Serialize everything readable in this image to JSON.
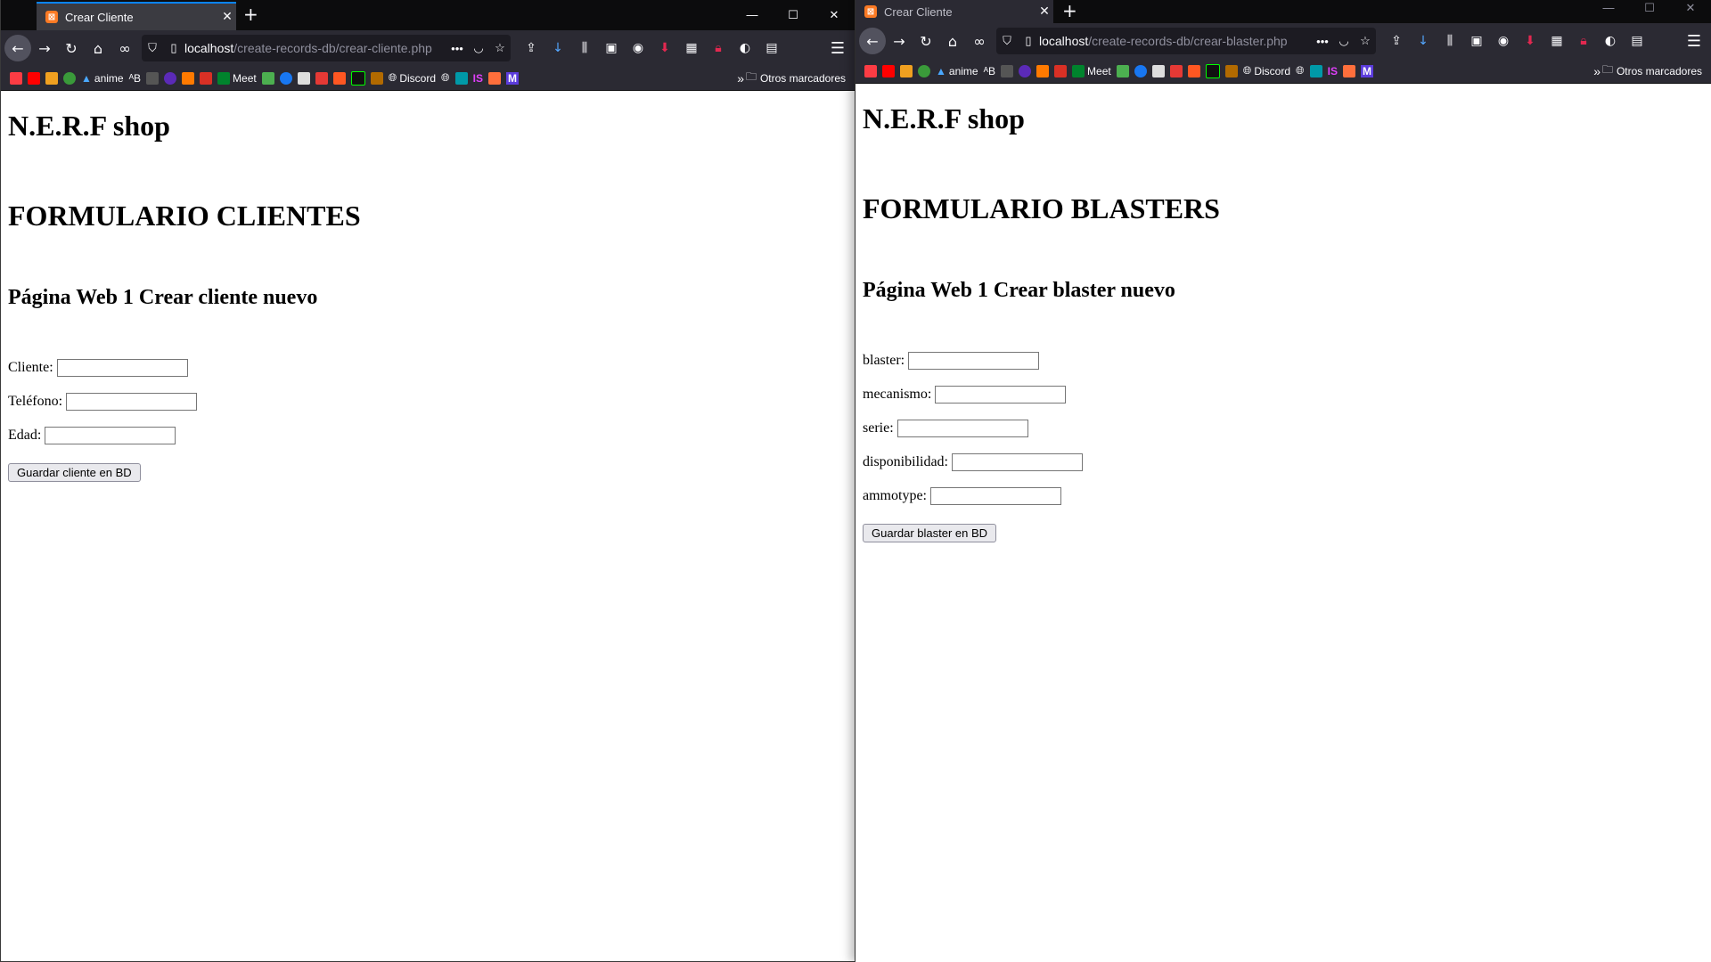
{
  "windows": [
    {
      "tab_title": "Crear Cliente",
      "url_host": "localhost",
      "url_path": "/create-records-db/crear-cliente.php",
      "page": {
        "heading1": "N.E.R.F shop",
        "heading2": "FORMULARIO CLIENTES",
        "heading3": "Página Web 1 Crear cliente nuevo",
        "fields": [
          {
            "label": "Cliente:",
            "value": ""
          },
          {
            "label": "Teléfono:",
            "value": ""
          },
          {
            "label": "Edad:",
            "value": ""
          }
        ],
        "submit_label": "Guardar cliente en BD"
      }
    },
    {
      "tab_title": "Crear Cliente",
      "url_host": "localhost",
      "url_path": "/create-records-db/crear-blaster.php",
      "page": {
        "heading1": "N.E.R.F shop",
        "heading2": "FORMULARIO BLASTERS",
        "heading3": "Página Web 1 Crear blaster nuevo",
        "fields": [
          {
            "label": "blaster:",
            "value": ""
          },
          {
            "label": "mecanismo:",
            "value": ""
          },
          {
            "label": "serie:",
            "value": ""
          },
          {
            "label": "disponibilidad:",
            "value": ""
          },
          {
            "label": "ammotype:",
            "value": ""
          }
        ],
        "submit_label": "Guardar blaster en BD"
      }
    }
  ],
  "bookmarks": {
    "anime_label": "anime",
    "meet_label": "Meet",
    "discord_label": "Discord",
    "other_label": "Otros marcadores",
    "ab_label": "ᴬB",
    "is_label": "IS",
    "m_label": "M"
  },
  "colors": {
    "tab_accent": "#0a84ff",
    "chrome_bg": "#2b2a33",
    "favicon": "#fb7a24"
  }
}
